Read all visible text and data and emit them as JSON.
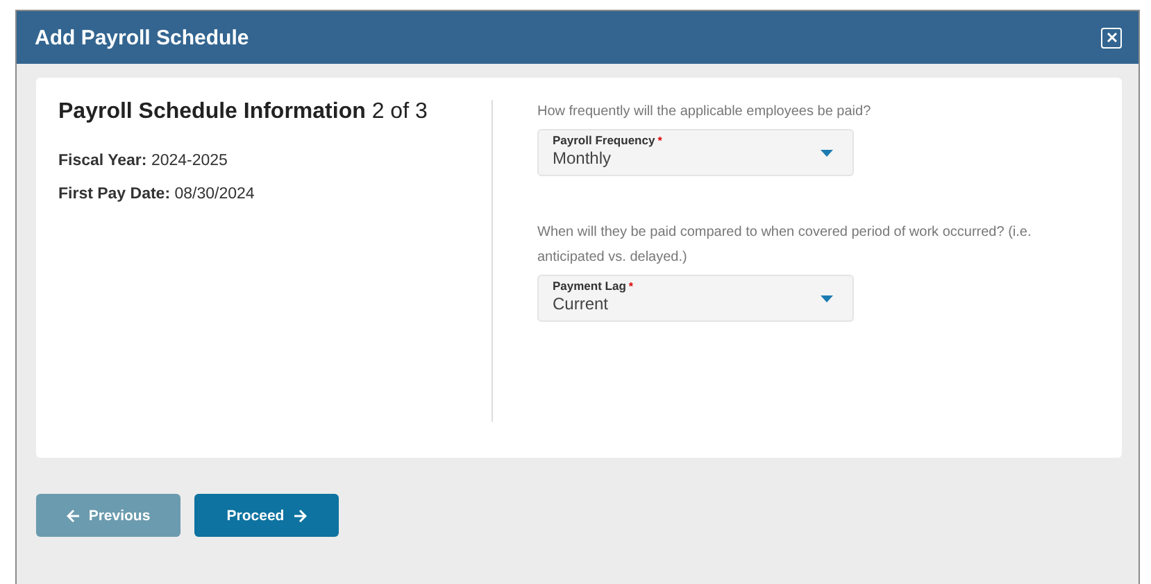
{
  "dialog": {
    "title": "Add Payroll Schedule"
  },
  "info": {
    "heading": "Payroll Schedule Information",
    "step": "2 of 3",
    "details": [
      {
        "label": "Fiscal Year:",
        "value": "2024-2025"
      },
      {
        "label": "First Pay Date:",
        "value": "08/30/2024"
      }
    ]
  },
  "questions": [
    {
      "prompt": "How frequently will the applicable employees be paid?",
      "field_label": "Payroll Frequency",
      "required_mark": "*",
      "value": "Monthly"
    },
    {
      "prompt": "When will they be paid compared to when covered period of work occurred? (i.e. anticipated vs. delayed.)",
      "field_label": "Payment Lag",
      "required_mark": "*",
      "value": "Current"
    }
  ],
  "buttons": [
    {
      "label": "Previous",
      "kind": "back",
      "disabled": true
    },
    {
      "label": "Proceed",
      "kind": "forward",
      "disabled": false
    }
  ]
}
